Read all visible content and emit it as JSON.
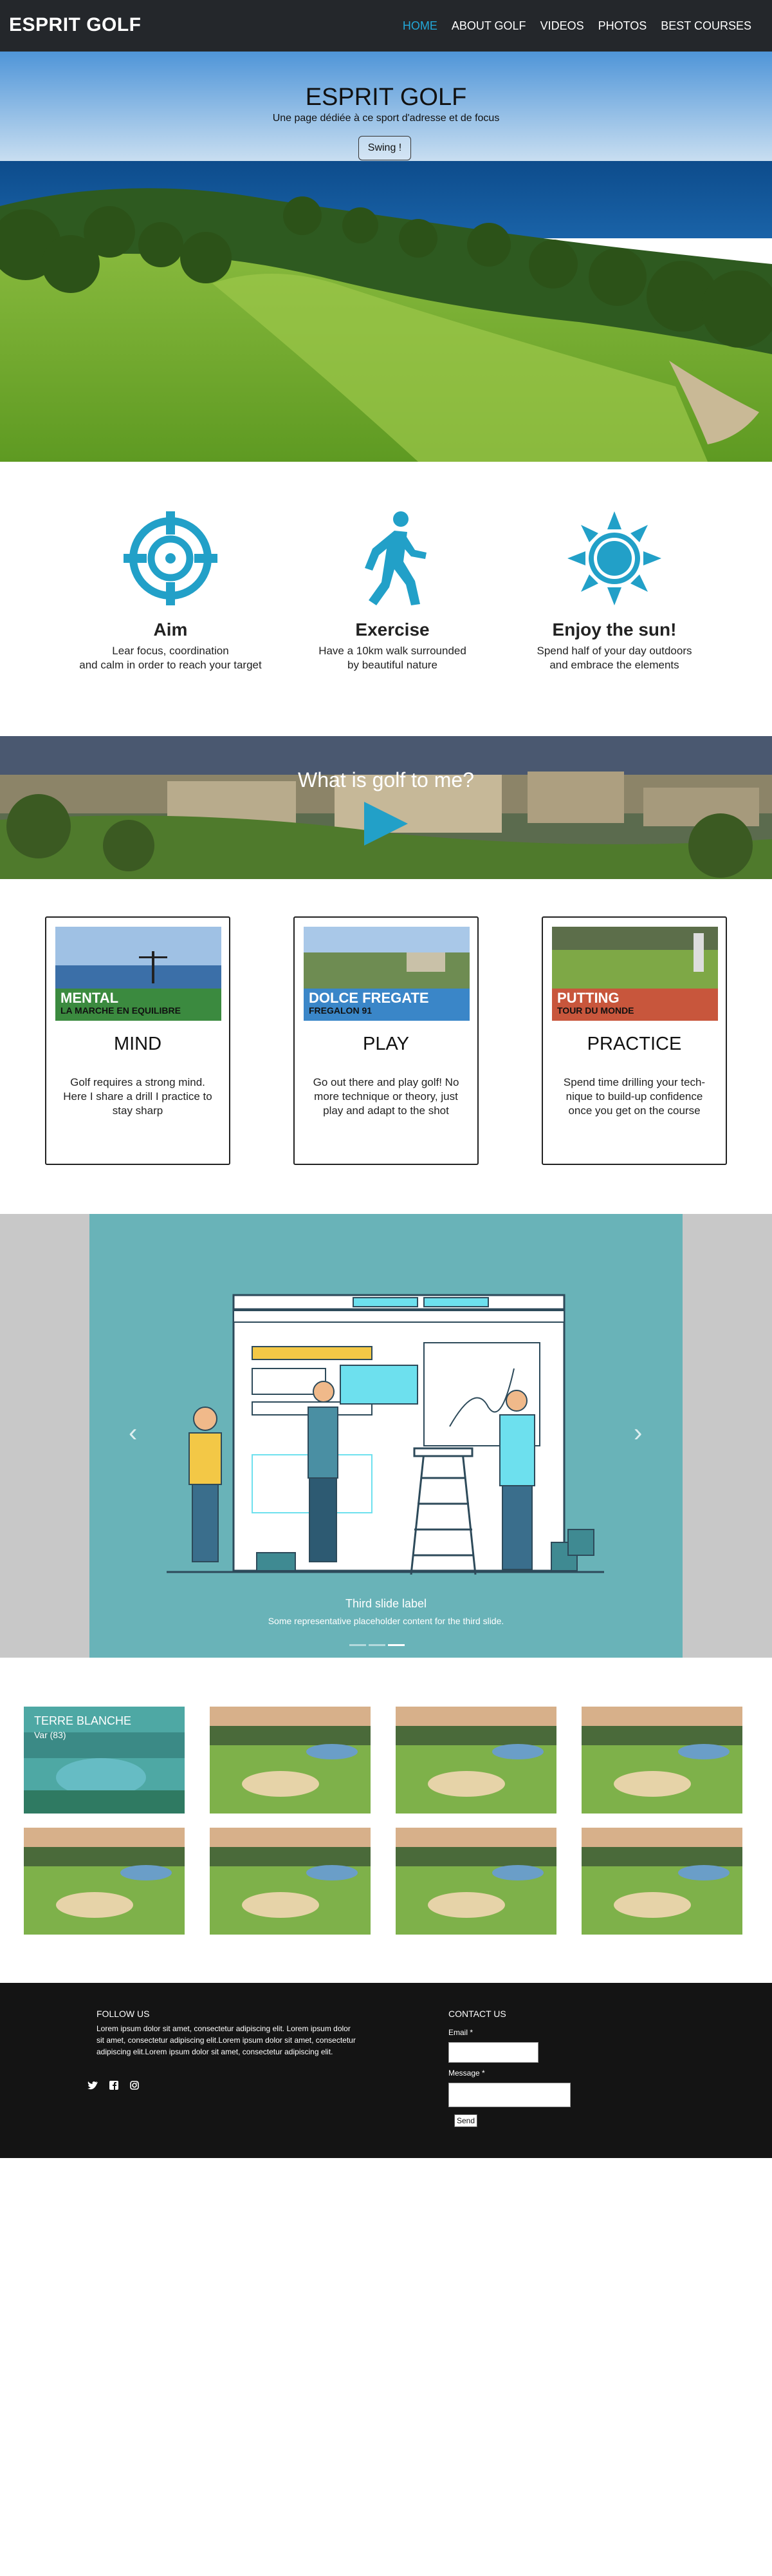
{
  "header": {
    "brand": "ESPRIT GOLF",
    "menu": [
      "HOME",
      "ABOUT GOLF",
      "VIDEOS",
      "PHOTOS",
      "BEST COURSES"
    ],
    "active_color": "#22a7d8"
  },
  "hero": {
    "title": "ESPRIT GOLF",
    "subtitle": "Une page dédiée à ce sport d'adresse et de focus",
    "button": "Swing !"
  },
  "features": [
    {
      "icon": "target-icon",
      "title": "Aim",
      "line1": "Lear focus, coordination",
      "line2": "and calm in order to reach your target"
    },
    {
      "icon": "walking-person-icon",
      "title": "Exercise",
      "line1": "Have a 10km walk surrounded",
      "line2": "by beautiful nature"
    },
    {
      "icon": "sun-icon",
      "title": "Enjoy the sun!",
      "line1": "Spend half of your day outdoors",
      "line2": "and embrace the elements"
    }
  ],
  "video": {
    "title": "What is golf to me?",
    "icon": "play-icon"
  },
  "cards": [
    {
      "label1": "MENTAL",
      "label2": "LA MARCHE EN EQUILIBRE",
      "band": "#3b8a3f",
      "title": "MIND",
      "lines": [
        "Golf requires a strong mind.",
        "Here I share a drill I practice to",
        "stay sharp"
      ]
    },
    {
      "label1": "DOLCE FREGATE",
      "label2": "FREGALON 91",
      "band": "#3a86c8",
      "title": "PLAY",
      "lines": [
        "Go out there and play golf! No",
        "more technique or theory, just",
        "play and adapt to the shot"
      ]
    },
    {
      "label1": "PUTTING",
      "label2": "TOUR DU MONDE",
      "band": "#c8563c",
      "title": "PRACTICE",
      "lines": [
        "Spend time drilling your tech-",
        "nique to build-up confidence",
        "once you get on the course"
      ]
    }
  ],
  "carousel": {
    "label": "Third slide label",
    "caption": "Some representative placeholder content for the third slide.",
    "prev_icon": "‹",
    "next_icon": "›",
    "active_slide": 3,
    "slide_count": 3
  },
  "gallery": {
    "first_title": "TERRE BLANCHE",
    "first_sub": "Var (83)"
  },
  "footer": {
    "follow_title": "FOLLOW US",
    "follow_text": "Lorem ipsum dolor sit amet, consectetur adipiscing elit. Lorem ipsum dolor sit amet, consectetur adipiscing elit.Lorem ipsum dolor sit amet, consectetur adipiscing elit.Lorem ipsum dolor sit amet, consectetur adipiscing elit.",
    "social_icons": [
      "twitter-icon",
      "facebook-icon",
      "instagram-icon"
    ],
    "contact_title": "CONTACT US",
    "email_label": "Email *",
    "message_label": "Message *",
    "send_label": "Send"
  }
}
